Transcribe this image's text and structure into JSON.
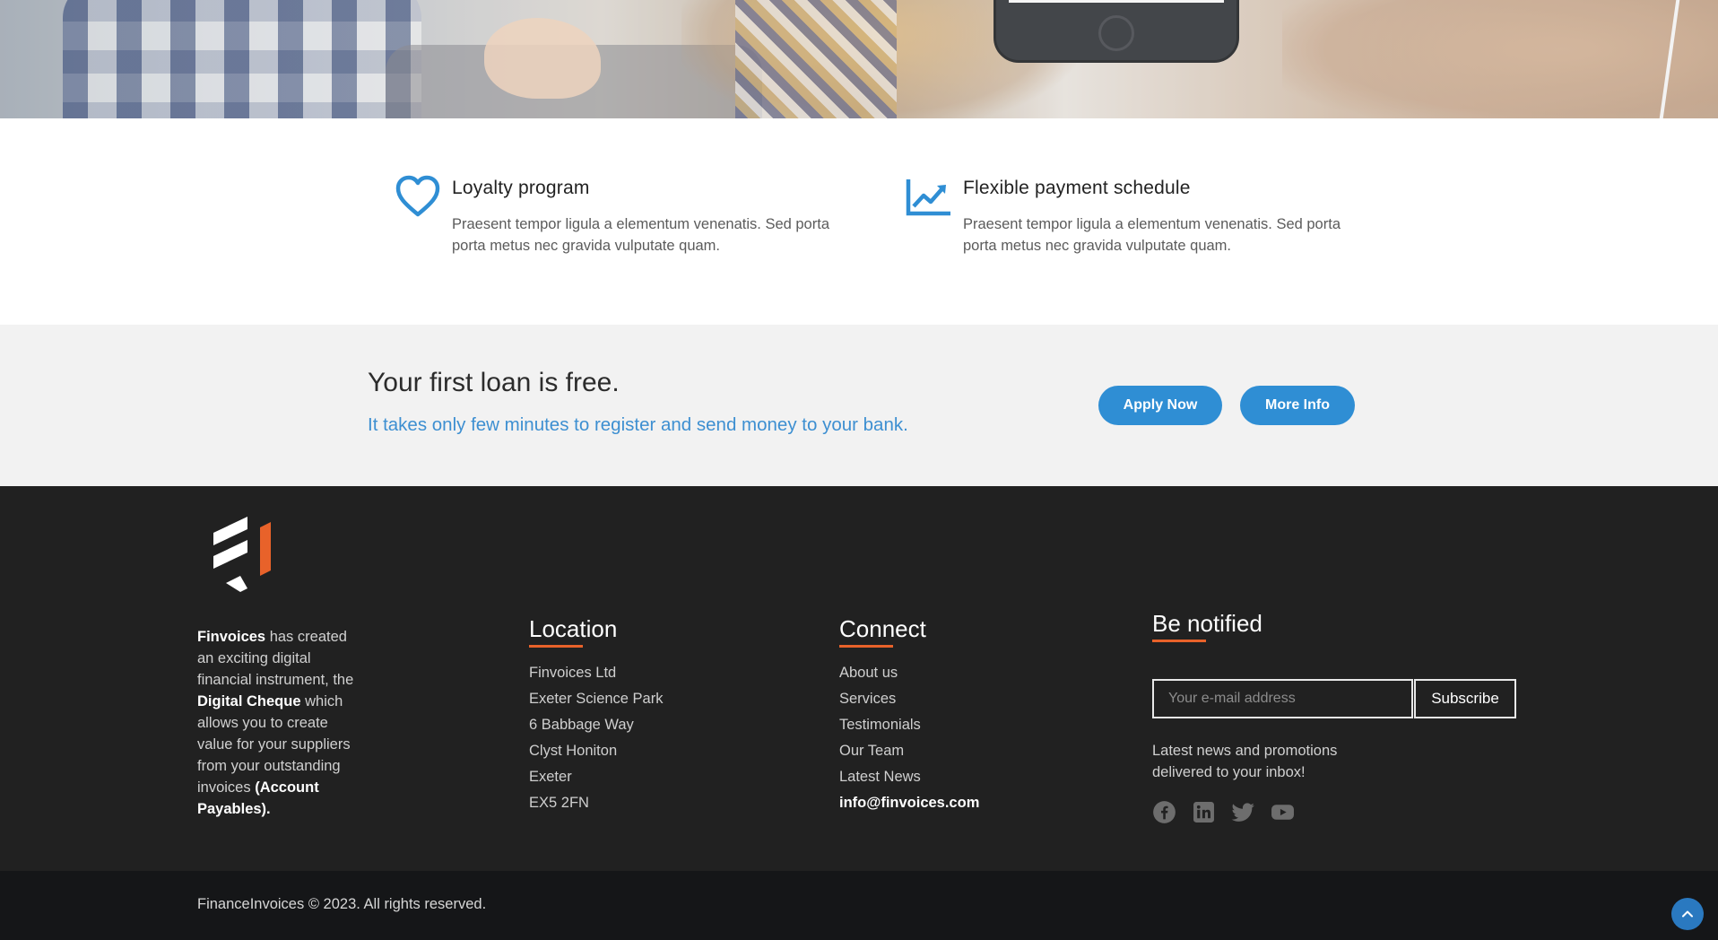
{
  "features": [
    {
      "icon": "heart-icon",
      "title": "Loyalty program",
      "text": "Praesent tempor ligula a elementum venenatis. Sed porta porta metus nec gravida vulputate quam."
    },
    {
      "icon": "chart-trend-icon",
      "title": "Flexible payment schedule",
      "text": "Praesent tempor ligula a elementum venenatis. Sed porta porta metus nec gravida vulputate quam."
    }
  ],
  "cta": {
    "title": "Your first loan is free.",
    "subtitle": "It takes only few minutes to register and send money to your bank.",
    "apply_label": "Apply Now",
    "more_label": "More Info"
  },
  "footer": {
    "about": {
      "brand": "Finvoices",
      "t1": " has created an exciting digital financial instrument, the ",
      "product": "Digital Cheque",
      "t2": " which allows you to create value for your suppliers from your outstanding invoices ",
      "tail": "(Account Payables)."
    },
    "location": {
      "title": "Location",
      "lines": [
        "Finvoices Ltd",
        "Exeter Science Park",
        "6 Babbage Way",
        "Clyst Honiton",
        "Exeter",
        "EX5 2FN"
      ]
    },
    "connect": {
      "title": "Connect",
      "links": [
        "About us",
        "Services",
        "Testimonials",
        "Our Team",
        "Latest News"
      ],
      "email": "info@finvoices.com"
    },
    "notify": {
      "title": "Be notified",
      "placeholder": "Your e-mail address",
      "subscribe_label": "Subscribe",
      "text": "Latest news and promotions delivered to your inbox!",
      "socials": [
        "facebook-icon",
        "linkedin-icon",
        "twitter-icon",
        "youtube-icon"
      ]
    }
  },
  "bottom": {
    "copyright": "FinanceInvoices © 2023. All rights reserved."
  },
  "colors": {
    "accent_blue": "#2f8ed4",
    "accent_orange": "#e8622a",
    "footer_bg": "#212121",
    "bottom_bg": "#151618"
  }
}
